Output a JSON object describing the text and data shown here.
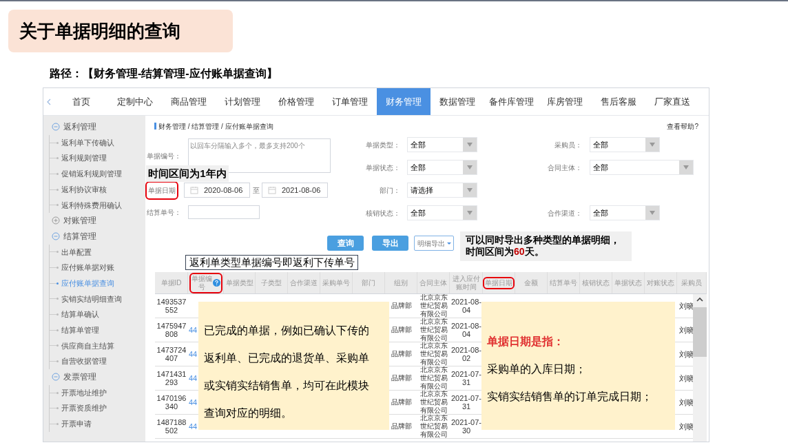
{
  "slide_title": "关于单据明细的查询",
  "path_text": "路径：【财务管理-结算管理-应付账单据查询】",
  "nav_tabs": [
    {
      "label": "首页",
      "selected": false
    },
    {
      "label": "定制中心",
      "selected": false
    },
    {
      "label": "商品管理",
      "selected": false
    },
    {
      "label": "计划管理",
      "selected": false
    },
    {
      "label": "价格管理",
      "selected": false
    },
    {
      "label": "订单管理",
      "selected": false
    },
    {
      "label": "财务管理",
      "selected": true
    },
    {
      "label": "数据管理",
      "selected": false
    },
    {
      "label": "备件库管理",
      "selected": false
    },
    {
      "label": "库房管理",
      "selected": false
    },
    {
      "label": "售后客服",
      "selected": false
    },
    {
      "label": "厂家直送",
      "selected": false
    }
  ],
  "sidebar": [
    {
      "label": "返利管理",
      "expanded": true,
      "children": [
        {
          "label": "返利单下传确认",
          "selected": false
        },
        {
          "label": "返利规则管理",
          "selected": false
        },
        {
          "label": "促销返利规则管理",
          "selected": false
        },
        {
          "label": "返利协议审核",
          "selected": false
        },
        {
          "label": "返利特殊费用确认",
          "selected": false
        }
      ]
    },
    {
      "label": "对账管理",
      "expanded": false
    },
    {
      "label": "结算管理",
      "expanded": true,
      "children": [
        {
          "label": "出单配置",
          "selected": false
        },
        {
          "label": "应付账单据对账",
          "selected": false
        },
        {
          "label": "应付账单据查询",
          "selected": true
        },
        {
          "label": "实销实结明细查询",
          "selected": false
        },
        {
          "label": "结算单确认",
          "selected": false
        },
        {
          "label": "结算单管理",
          "selected": false
        },
        {
          "label": "供应商自主结算",
          "selected": false
        },
        {
          "label": "自营收据管理",
          "selected": false
        }
      ]
    },
    {
      "label": "发票管理",
      "expanded": true,
      "children": [
        {
          "label": "开票地址维护",
          "selected": false
        },
        {
          "label": "开票资质维护",
          "selected": false
        },
        {
          "label": "开票申请",
          "selected": false
        }
      ]
    }
  ],
  "breadcrumb": "财务管理 / 结算管理 / 应付账单据查询",
  "help_link": "查看帮助?",
  "form_left": [
    {
      "kind": "textarea",
      "label": "单据编号：",
      "placeholder": "以回车分隔输入多个，最多支持200个",
      "marked": false
    },
    {
      "kind": "daterange",
      "label": "单据日期",
      "from": "2020-08-06",
      "separator": "至",
      "to": "2021-08-06",
      "marked": true
    },
    {
      "kind": "input",
      "label": "结算单号：",
      "marked": false
    }
  ],
  "form_middle": [
    {
      "label": "单据类型：",
      "value": "全部"
    },
    {
      "label": "单据状态：",
      "value": "全部"
    },
    {
      "label": "部门：",
      "value": "请选择"
    },
    {
      "label": "核销状态：",
      "value": "全部"
    }
  ],
  "form_right": [
    {
      "label": "采购员：",
      "value": "全部",
      "wide": false
    },
    {
      "label": "合同主体：",
      "value": "全部",
      "wide": true
    },
    {
      "label": "合作渠道：",
      "value": "全部",
      "wide": false
    }
  ],
  "buttons": [
    "查询",
    "导出"
  ],
  "export_dropdown": "明细导出",
  "table": {
    "columns": [
      {
        "label": "单据ID",
        "marked": false,
        "help": false
      },
      {
        "label": "单据编号",
        "marked": true,
        "help": true
      },
      {
        "label": "单据类型",
        "marked": false,
        "help": false
      },
      {
        "label": "子类型",
        "marked": false,
        "help": false
      },
      {
        "label": "合作渠道",
        "marked": false,
        "help": false
      },
      {
        "label": "采购单号",
        "marked": false,
        "help": false
      },
      {
        "label": "部门",
        "marked": false,
        "help": false
      },
      {
        "label": "组别",
        "marked": false,
        "help": false
      },
      {
        "label": "合同主体",
        "marked": false,
        "help": false
      },
      {
        "label": "进入应付账时间",
        "marked": false,
        "help": false
      },
      {
        "label": "单据日期",
        "marked": true,
        "help": false
      },
      {
        "label": "金额",
        "marked": false,
        "help": false
      },
      {
        "label": "结算单号",
        "marked": false,
        "help": false
      },
      {
        "label": "核销状态",
        "marked": false,
        "help": false
      },
      {
        "label": "单据状态",
        "marked": false,
        "help": false
      },
      {
        "label": "对账状态",
        "marked": false,
        "help": false
      },
      {
        "label": "采购员",
        "marked": false,
        "help": false
      }
    ],
    "rows": [
      {
        "id": "1493537552",
        "group": "品牌部",
        "contract_party": "北京京东世纪贸易有限公司",
        "entry_time": "2021-08-04",
        "buyer": "刘晓"
      },
      {
        "id": "1475947808",
        "doc_no": "44",
        "group": "品牌部",
        "contract_party": "北京京东世纪贸易有限公司",
        "entry_time": "2021-08-04",
        "buyer": "刘晓"
      },
      {
        "id": "1473724407",
        "doc_no": "44",
        "group": "品牌部",
        "contract_party": "北京京东世纪贸易有限公司",
        "entry_time": "2021-08-02",
        "buyer": "刘晓"
      },
      {
        "id": "1471431293",
        "doc_no": "44",
        "group": "品牌部",
        "contract_party": "北京京东世纪贸易有限公司",
        "entry_time": "2021-07-31",
        "buyer": "刘晓"
      },
      {
        "id": "1470196340",
        "doc_no": "44",
        "group": "品牌部",
        "contract_party": "北京京东世纪贸易有限公司",
        "entry_time": "2021-07-31",
        "buyer": "刘晓"
      },
      {
        "id": "1487188502",
        "doc_no": "44",
        "group": "品牌部",
        "contract_party": "北京京东世纪贸易有限公司",
        "entry_time": "2021-07-30",
        "buyer": "刘晓"
      }
    ]
  },
  "notes": {
    "date_range": "时间区间为1年内",
    "export": {
      "line1": "可以同时导出多种类型的单据明细，",
      "before": "时间区间为",
      "highlight": "60",
      "after": "天。"
    },
    "doc_no": "返利单类型单据编号即返利下传单号",
    "completed": [
      "已完成的单据，例如已确认下传的",
      "返利单、已完成的退货单、采购单",
      "或实销实结销售单，均可在此模块",
      "查询对应的明细。"
    ],
    "bill_date": {
      "heading": "单据日期是指：",
      "lines": [
        "采购单的入库日期；",
        "实销实结销售单的订单完成日期；"
      ]
    }
  }
}
